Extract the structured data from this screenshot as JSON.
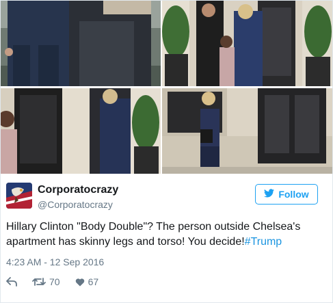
{
  "tweet": {
    "display_name": "Corporatocrazy",
    "handle": "@Corporatocrazy",
    "follow_label": "Follow",
    "text_main": "Hillary Clinton \"Body Double\"? The person outside Chelsea's apartment has skinny legs and torso! You decide!",
    "hashtag": "#Trump",
    "timestamp": "4:23 AM - 12 Sep 2016",
    "retweets": "70",
    "likes": "67"
  },
  "icons": {
    "reply": "reply-icon",
    "retweet": "retweet-icon",
    "like": "heart-icon",
    "follow": "bird-icon"
  },
  "colors": {
    "accent": "#1da1f2",
    "hashtag": "#1b95e0",
    "muted": "#657786",
    "text": "#14171a"
  }
}
